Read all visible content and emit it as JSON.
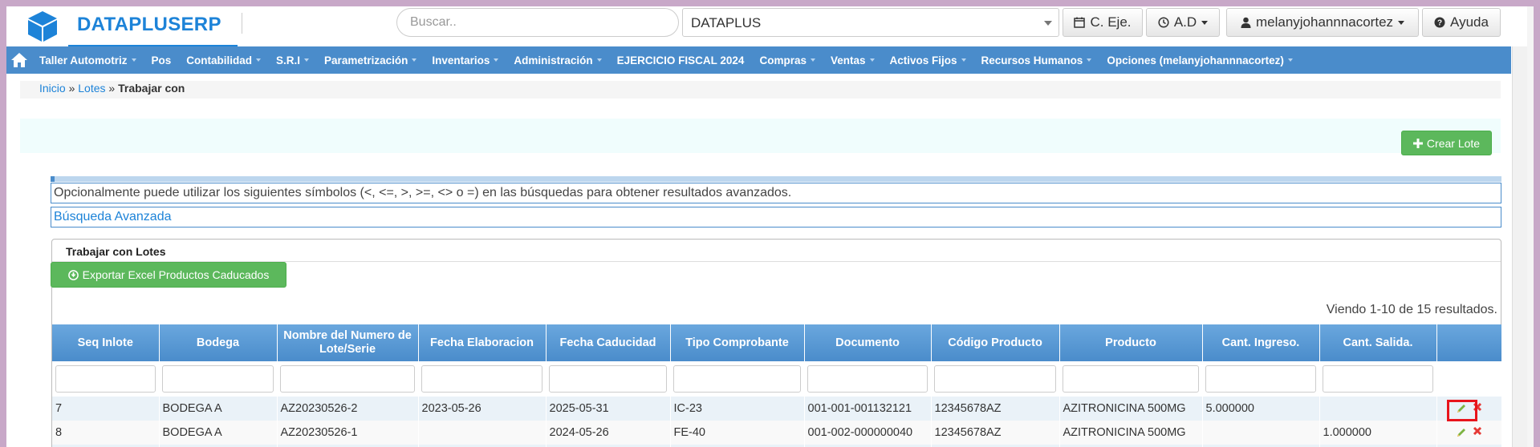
{
  "brand": {
    "name": "DATAPLUSERP",
    "color": "#1d83d8"
  },
  "search": {
    "placeholder": "Buscar.."
  },
  "company_select": {
    "value": "DATAPLUS"
  },
  "header_buttons": {
    "ejercicio": "C. Eje.",
    "ad": "A.D",
    "user": "melanyjohannnacortez",
    "help": "Ayuda"
  },
  "nav": {
    "items": [
      "Taller Automotriz",
      "Pos",
      "Contabilidad",
      "S.R.I",
      "Parametrización",
      "Inventarios",
      "Administración",
      "EJERCICIO FISCAL 2024",
      "Compras",
      "Ventas",
      "Activos Fijos",
      "Recursos Humanos",
      "Opciones (melanyjohannnacortez)"
    ]
  },
  "breadcrumb": {
    "home": "Inicio",
    "lotes": "Lotes",
    "current": "Trabajar con"
  },
  "actions": {
    "crear": "Crear Lote",
    "export": "Exportar Excel Productos Caducados"
  },
  "info": {
    "symbols": "Opcionalmente puede utilizar los siguientes símbolos (<, <=, >, >=, <> o =) en las búsquedas para obtener resultados avanzados.",
    "advanced": "Búsqueda Avanzada"
  },
  "panel": {
    "title": "Trabajar con Lotes",
    "summary": "Viendo 1-10 de 15 resultados."
  },
  "table": {
    "headers": [
      "Seq Inlote",
      "Bodega",
      "Nombre del Numero de Lote/Serie",
      "Fecha Elaboracion",
      "Fecha Caducidad",
      "Tipo Comprobante",
      "Documento",
      "Código Producto",
      "Producto",
      "Cant. Ingreso.",
      "Cant. Salida."
    ],
    "rows": [
      [
        "7",
        "BODEGA A",
        "AZ20230526-2",
        "2023-05-26",
        "2025-05-31",
        "IC-23",
        "001-001-001132121",
        "12345678AZ",
        "AZITRONICINA 500MG",
        "5.000000",
        ""
      ],
      [
        "8",
        "BODEGA A",
        "AZ20230526-1",
        "",
        "2024-05-26",
        "FE-40",
        "001-002-000000040",
        "12345678AZ",
        "AZITRONICINA 500MG",
        "",
        "1.000000"
      ]
    ]
  },
  "colors": {
    "nav": "#4a8ccb",
    "header_th": "#5e9bd3",
    "success": "#5cb85c",
    "highlight": "#e8141c"
  }
}
